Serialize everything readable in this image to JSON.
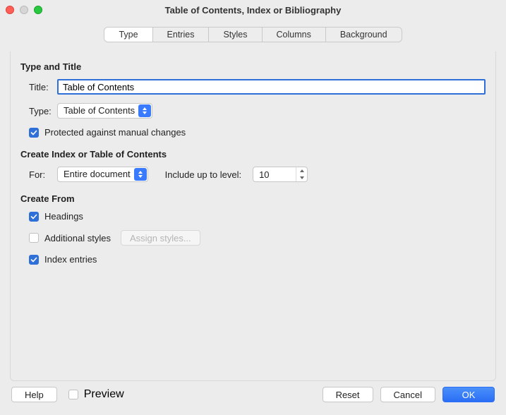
{
  "window": {
    "title": "Table of Contents, Index or Bibliography"
  },
  "tabs": {
    "type": "Type",
    "entries": "Entries",
    "styles": "Styles",
    "columns": "Columns",
    "background": "Background"
  },
  "sections": {
    "typeAndTitle": "Type and Title",
    "createIndex": "Create Index or Table of Contents",
    "createFrom": "Create From"
  },
  "labels": {
    "title": "Title:",
    "type": "Type:",
    "for": "For:",
    "includeUpTo": "Include up to level:",
    "protected": "Protected against manual changes",
    "headings": "Headings",
    "additionalStyles": "Additional styles",
    "assignStyles": "Assign styles...",
    "indexEntries": "Index entries",
    "preview": "Preview"
  },
  "values": {
    "title": "Table of Contents",
    "type": "Table of Contents",
    "for": "Entire document",
    "level": "10"
  },
  "buttons": {
    "help": "Help",
    "reset": "Reset",
    "cancel": "Cancel",
    "ok": "OK"
  }
}
